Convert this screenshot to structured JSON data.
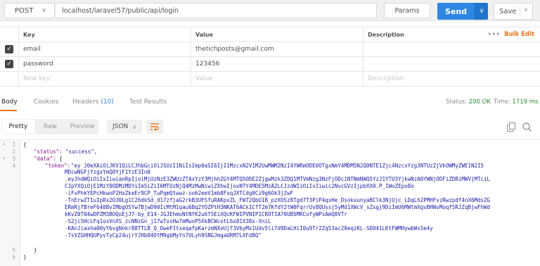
{
  "request": {
    "method": "POST",
    "url": "localhost/laravel57/public/api/login",
    "params_label": "Params",
    "send_label": "Send",
    "save_label": "Save"
  },
  "params_table": {
    "headers": {
      "key": "Key",
      "value": "Value",
      "description": "Description"
    },
    "more": "•••",
    "bulk_edit": "Bulk Edit",
    "rows": [
      {
        "key": "email",
        "value": "thetichposts@gmail.com",
        "checked": true
      },
      {
        "key": "password",
        "value": "123456",
        "checked": true
      }
    ],
    "new_row": {
      "key_placeholder": "New key",
      "value_placeholder": "Value",
      "description_placeholder": "Description"
    }
  },
  "response_tabs": {
    "body": "Body",
    "cookies": "Cookies",
    "headers": "Headers",
    "headers_count": "(10)",
    "test_results": "Test Results",
    "status_label": "Status:",
    "status_value": "200 OK",
    "time_label": "Time:",
    "time_value": "1719 ms"
  },
  "format_bar": {
    "pretty": "Pretty",
    "raw": "Raw",
    "preview": "Preview",
    "format": "JSON",
    "icons": [
      "wrap-icon",
      "copy-icon",
      "search-icon"
    ]
  },
  "code": {
    "line_numbers": [
      "1",
      "2",
      "3",
      "4",
      "5",
      "6"
    ],
    "open_brace": "{",
    "status_key": "\"status\":",
    "status_value": "\"success\",",
    "data_key": "\"data\":",
    "data_open": "{",
    "token_key": "\"token\":",
    "token_lines": [
      "\"ey J0eXAiOiJKV1QiLCJhbGciOiJSUzI1NiIsImp0aSI6IjI1MzcxN2V1M2UwMWM2NzI4YWRmODE0OTgxNmY4MDM5N2Q0NTE1Zjc4NzcxYzg3NTUzZjVkOWMyZWE1N2I5",
      "MDcwNGFjYzgxYmQ0YjF1YzE3In0",
      ".eyJhdWQiOiIxIiwianRpIjoiMjUzNzE3ZWUzZTAxYzY3MjhhZGY4MTQ5ODE2ZjgwMzk3ZDQ1MTVmNzg3NzFjODc1NTNmNWQ5YzJ1YTU3YjkwNzA0YWNjODFiZDRiMWVjMTciL",
      "CJpYXQiOjE1MzY0ODMzMDYsIm5iZiI6MTUzNjQ4MzMwNiwiZXhwIjoxNTY4MDE5MzA2LCJzdWIiOiIxIiwic2NvcGVzIjpbXX0.P_IWoZEpo8o",
      "-iFvPhkYEPcHkwoP2HxZkeEr9CP_TuPqmQtwwz-so62eeV1mb8FxqJXTCdg0Cz9g6Ok3j2wF",
      "-TnErwZT1uIpRx2OJ0Lg1C26dkSd_d17zfjaG2rkB3UFSfuRAKpxZL_FW72QbU1B_pzXOSz8Tgd7T3PiP4qsHe_DsokxunyaBClk3NjUjc_LDqLh2PMHFvzRwzpdf4nX6MdsZG",
      "ERmRjfBreF640BvIMbgOSYw7BjwD90IcMtM1qau6Bq2YOZPtH3NKAT6ACk1CfT2m7KfdY2tW0FqrrUv8QUssj5yMd1XWcV_sZxgj9DiImU6MWtmXgvBHWvMoqf5RJZqBjwFhWd",
      "kKvZ0T04wDPZM3BOQoEjJ7-by_E14-JGJEhmoNtNfK2u6T5EiXQcKFWIPVNIP1CROTIA70UB5MRCofyWPsAmQ8VTr",
      "-S2jc5HcLFq1oxVnXS_zcNNzGn_j17wTvsHw7mMuoP5XkBCWcotL6x81X38x-XniL",
      "-KAnJiaxha00yYbvgNnkr88TTLB_Q_OwePJtxeqafpKarzmNXoUjf3VbyMx1Udv5li7d9DaLHiI0u9Tr2Zq53ac20eqzKL-SD041LKtFWMHywbWs5e4y",
      "-7sVZGHHQUPyvTyCp24ujrYJHb84OtM9gbMyYn7ULyh9SNGJmgaURM7LXFd8Q\""
    ],
    "data_close": "}",
    "close_brace": "}"
  }
}
